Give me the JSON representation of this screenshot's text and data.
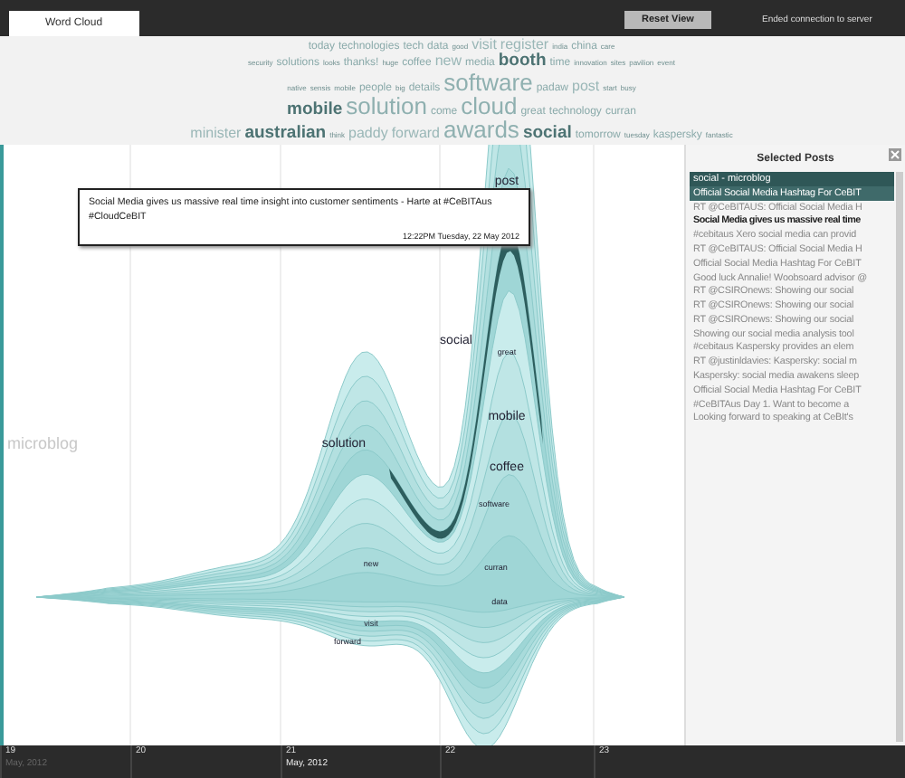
{
  "toolbar": {
    "tabs": [
      {
        "label": "Word Cloud",
        "selected": true
      }
    ],
    "reset_button": "Reset View",
    "status": "Ended connection to server"
  },
  "word_cloud": {
    "lines": [
      [
        {
          "text": "today",
          "kind": "small"
        },
        {
          "text": "technologies",
          "kind": "small"
        },
        {
          "text": "tech",
          "kind": "small"
        },
        {
          "text": "data",
          "kind": "small"
        },
        {
          "text": "good",
          "kind": "tiny"
        },
        {
          "text": "visit",
          "kind": "medium"
        },
        {
          "text": "register",
          "kind": "medium"
        },
        {
          "text": "india",
          "kind": "tiny"
        },
        {
          "text": "china",
          "kind": "small"
        },
        {
          "text": "care",
          "kind": "tiny"
        }
      ],
      [
        {
          "text": "security",
          "kind": "tiny"
        },
        {
          "text": "solutions",
          "kind": "small"
        },
        {
          "text": "looks",
          "kind": "tiny"
        },
        {
          "text": "thanks!",
          "kind": "small"
        },
        {
          "text": "huge",
          "kind": "tiny"
        },
        {
          "text": "coffee",
          "kind": "small"
        },
        {
          "text": "new",
          "kind": "medium"
        },
        {
          "text": "media",
          "kind": "small"
        },
        {
          "text": "booth",
          "kind": "large"
        },
        {
          "text": "time",
          "kind": "small"
        },
        {
          "text": "innovation",
          "kind": "tiny"
        },
        {
          "text": "sites",
          "kind": "tiny"
        },
        {
          "text": "pavilion",
          "kind": "tiny"
        },
        {
          "text": "event",
          "kind": "tiny"
        }
      ],
      [
        {
          "text": "native",
          "kind": "tiny"
        },
        {
          "text": "sensis",
          "kind": "tiny"
        },
        {
          "text": "mobile",
          "kind": "tiny"
        },
        {
          "text": "people",
          "kind": "small"
        },
        {
          "text": "big",
          "kind": "tiny"
        },
        {
          "text": "details",
          "kind": "small"
        },
        {
          "text": "software",
          "kind": "huge"
        },
        {
          "text": "padaw",
          "kind": "small"
        },
        {
          "text": "post",
          "kind": "medium"
        },
        {
          "text": "start",
          "kind": "tiny"
        },
        {
          "text": "busy",
          "kind": "tiny"
        }
      ],
      [
        {
          "text": "mobile",
          "kind": "large"
        },
        {
          "text": "solution",
          "kind": "huge"
        },
        {
          "text": "come",
          "kind": "small"
        },
        {
          "text": "cloud",
          "kind": "huge"
        },
        {
          "text": "great",
          "kind": "small"
        },
        {
          "text": "technology",
          "kind": "small"
        },
        {
          "text": "curran",
          "kind": "small"
        }
      ],
      [
        {
          "text": "minister",
          "kind": "medium"
        },
        {
          "text": "australian",
          "kind": "large"
        },
        {
          "text": "think",
          "kind": "tiny"
        },
        {
          "text": "paddy",
          "kind": "medium"
        },
        {
          "text": "forward",
          "kind": "medium"
        },
        {
          "text": "awards",
          "kind": "huge"
        },
        {
          "text": "social",
          "kind": "large"
        },
        {
          "text": "tomorrow",
          "kind": "small"
        },
        {
          "text": "tuesday",
          "kind": "tiny"
        },
        {
          "text": "kaspersky",
          "kind": "small"
        },
        {
          "text": "fantastic",
          "kind": "tiny"
        }
      ]
    ]
  },
  "streamgraph": {
    "source_label": "microblog",
    "labels": [
      {
        "text": "post",
        "kind": "major"
      },
      {
        "text": "social",
        "kind": "major"
      },
      {
        "text": "great",
        "kind": "minor"
      },
      {
        "text": "mobile",
        "kind": "major"
      },
      {
        "text": "coffee",
        "kind": "major"
      },
      {
        "text": "software",
        "kind": "minor"
      },
      {
        "text": "solution",
        "kind": "major"
      },
      {
        "text": "curran",
        "kind": "minor"
      },
      {
        "text": "new",
        "kind": "minor"
      },
      {
        "text": "data",
        "kind": "minor"
      },
      {
        "text": "visit",
        "kind": "minor"
      },
      {
        "text": "forward",
        "kind": "minor"
      }
    ]
  },
  "tooltip": {
    "text": "Social Media gives us massive real time insight into customer sentiments - Harte at #CeBITAus #CloudCeBIT",
    "time": "12:22PM Tuesday, 22 May 2012"
  },
  "selected_posts": {
    "title": "Selected Posts",
    "group": "social - microblog",
    "posts": [
      {
        "text": "Official Social Media Hashtag For CeBIT",
        "selected": true,
        "emphasized": false
      },
      {
        "text": "RT @CeBITAUS: Official Social Media H",
        "selected": false,
        "emphasized": false
      },
      {
        "text": "Social Media gives us massive real time",
        "selected": false,
        "emphasized": true
      },
      {
        "text": "#cebitaus Xero social media can provid",
        "selected": false,
        "emphasized": false
      },
      {
        "text": "RT @CeBITAUS: Official Social Media H",
        "selected": false,
        "emphasized": false
      },
      {
        "text": "Official Social Media Hashtag For CeBIT",
        "selected": false,
        "emphasized": false
      },
      {
        "text": "Good luck Annalie! Woobsoard advisor @",
        "selected": false,
        "emphasized": false
      },
      {
        "text": "RT @CSIROnews: Showing our social",
        "selected": false,
        "emphasized": false
      },
      {
        "text": "RT @CSIROnews: Showing our social",
        "selected": false,
        "emphasized": false
      },
      {
        "text": "RT @CSIROnews: Showing our social",
        "selected": false,
        "emphasized": false
      },
      {
        "text": "Showing our social media analysis tool",
        "selected": false,
        "emphasized": false
      },
      {
        "text": "#cebitaus Kaspersky provides an elem",
        "selected": false,
        "emphasized": false
      },
      {
        "text": "RT @justinldavies: Kaspersky: social m",
        "selected": false,
        "emphasized": false
      },
      {
        "text": "Kaspersky: social media awakens sleep",
        "selected": false,
        "emphasized": false
      },
      {
        "text": "Official Social Media Hashtag For CeBIT",
        "selected": false,
        "emphasized": false
      },
      {
        "text": "#CeBITAus Day 1. Want to become a",
        "selected": false,
        "emphasized": false
      },
      {
        "text": "Looking forward to speaking at CeBIt's",
        "selected": false,
        "emphasized": false
      }
    ]
  },
  "axis": {
    "ticks": [
      {
        "label": "19",
        "month": "May, 2012",
        "month_dimmed": true
      },
      {
        "label": "20"
      },
      {
        "label": "21",
        "month": "May, 2012",
        "month_dimmed": false
      },
      {
        "label": "22"
      },
      {
        "label": "23"
      }
    ]
  }
}
